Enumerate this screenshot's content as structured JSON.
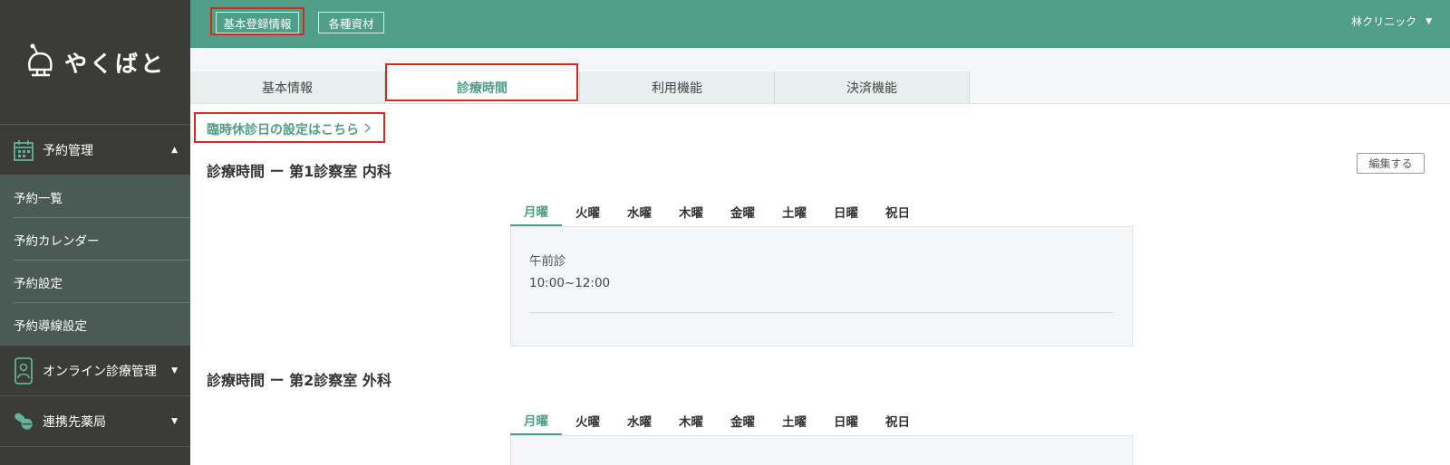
{
  "brand": {
    "name": "やくばと"
  },
  "sidebar": {
    "sections": [
      {
        "label": "予約管理",
        "icon": "calendar-icon",
        "expanded": true,
        "items": [
          {
            "label": "予約一覧"
          },
          {
            "label": "予約カレンダー"
          },
          {
            "label": "予約設定"
          },
          {
            "label": "予約導線設定"
          }
        ]
      },
      {
        "label": "オンライン診療管理",
        "icon": "phone-doctor-icon",
        "expanded": false
      },
      {
        "label": "連携先薬局",
        "icon": "pills-icon",
        "expanded": false
      }
    ]
  },
  "topbar": {
    "buttons": [
      {
        "label": "基本登録情報"
      },
      {
        "label": "各種資材"
      }
    ],
    "clinic_name": "林クリニック"
  },
  "tabs": [
    {
      "label": "基本情報",
      "active": false
    },
    {
      "label": "診療時間",
      "active": true
    },
    {
      "label": "利用機能",
      "active": false
    },
    {
      "label": "決済機能",
      "active": false
    }
  ],
  "holiday_link": "臨時休診日の設定はこちら",
  "edit_button": "編集する",
  "days": [
    "月曜",
    "火曜",
    "水曜",
    "木曜",
    "金曜",
    "土曜",
    "日曜",
    "祝日"
  ],
  "sections": [
    {
      "title": "診療時間 ー 第1診察室 内科",
      "active_day": "月曜",
      "slots": [
        {
          "name": "午前診",
          "time": "10:00~12:00"
        }
      ]
    },
    {
      "title": "診療時間 ー 第2診察室 外科",
      "active_day": "月曜",
      "slots": []
    }
  ],
  "colors": {
    "accent": "#4f9e87",
    "sidebar_bg": "#3b3b38",
    "submenu_bg": "#4a5a55",
    "highlight": "#d62a1e"
  }
}
